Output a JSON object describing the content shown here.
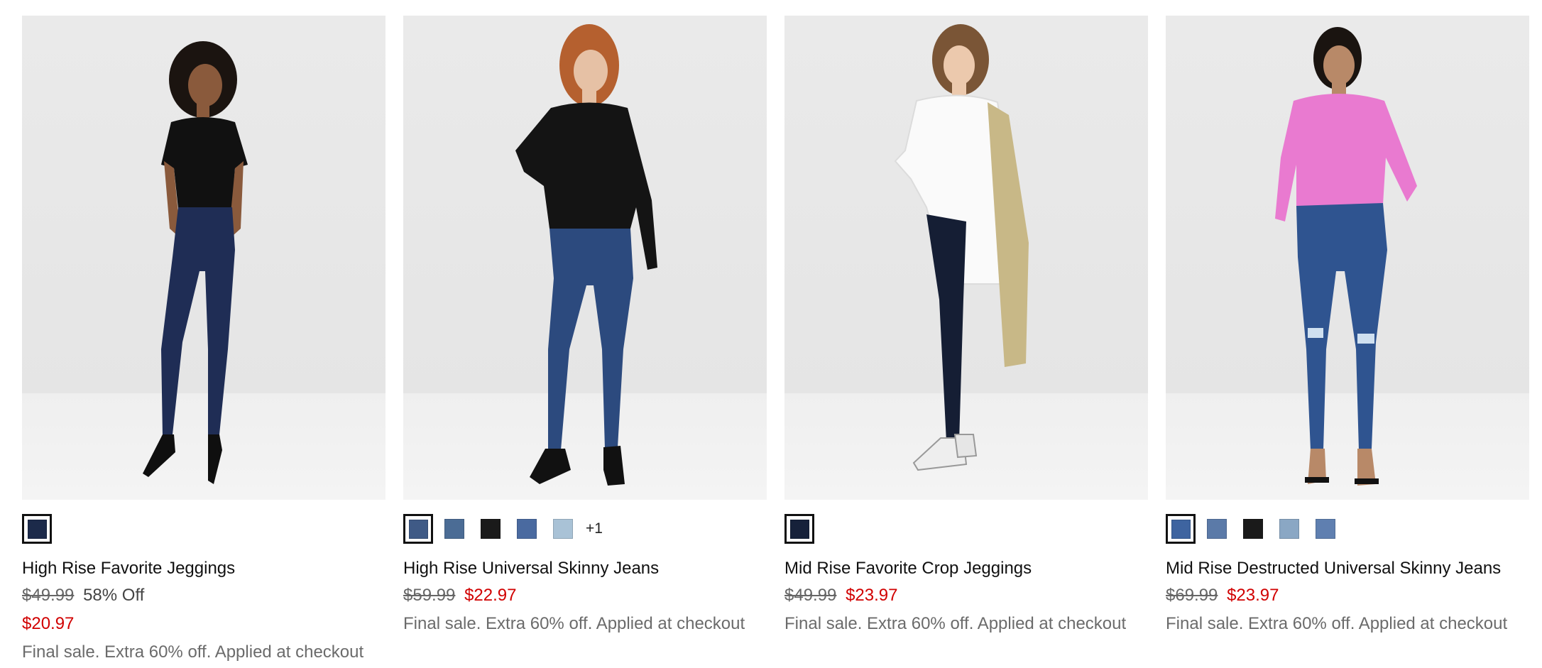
{
  "products": [
    {
      "name": "High Rise Favorite Jeggings",
      "original_price": "$49.99",
      "discount_text": "58% Off",
      "sale_price": "$20.97",
      "note": "Final sale. Extra 60% off. Applied at checkout",
      "swatches": [
        "#1c2a4a"
      ],
      "more_colors": ""
    },
    {
      "name": "High Rise Universal Skinny Jeans",
      "original_price": "$59.99",
      "discount_text": "",
      "sale_price": "$22.97",
      "note": "Final sale. Extra 60% off. Applied at checkout",
      "swatches": [
        "#3f5a86",
        "#4b6c95",
        "#1a1a1a",
        "#4a6aa0",
        "#a9c2d6"
      ],
      "more_colors": "+1"
    },
    {
      "name": "Mid Rise Favorite Crop Jeggings",
      "original_price": "$49.99",
      "discount_text": "",
      "sale_price": "$23.97",
      "note": "Final sale. Extra 60% off. Applied at checkout",
      "swatches": [
        "#16213a"
      ],
      "more_colors": ""
    },
    {
      "name": "Mid Rise Destructed Universal Skinny Jeans",
      "original_price": "$69.99",
      "discount_text": "",
      "sale_price": "$23.97",
      "note": "Final sale. Extra 60% off. Applied at checkout",
      "swatches": [
        "#3e64a0",
        "#5b7aa8",
        "#1a1a1a",
        "#8aa7c4",
        "#5f7fb0"
      ],
      "more_colors": ""
    }
  ]
}
